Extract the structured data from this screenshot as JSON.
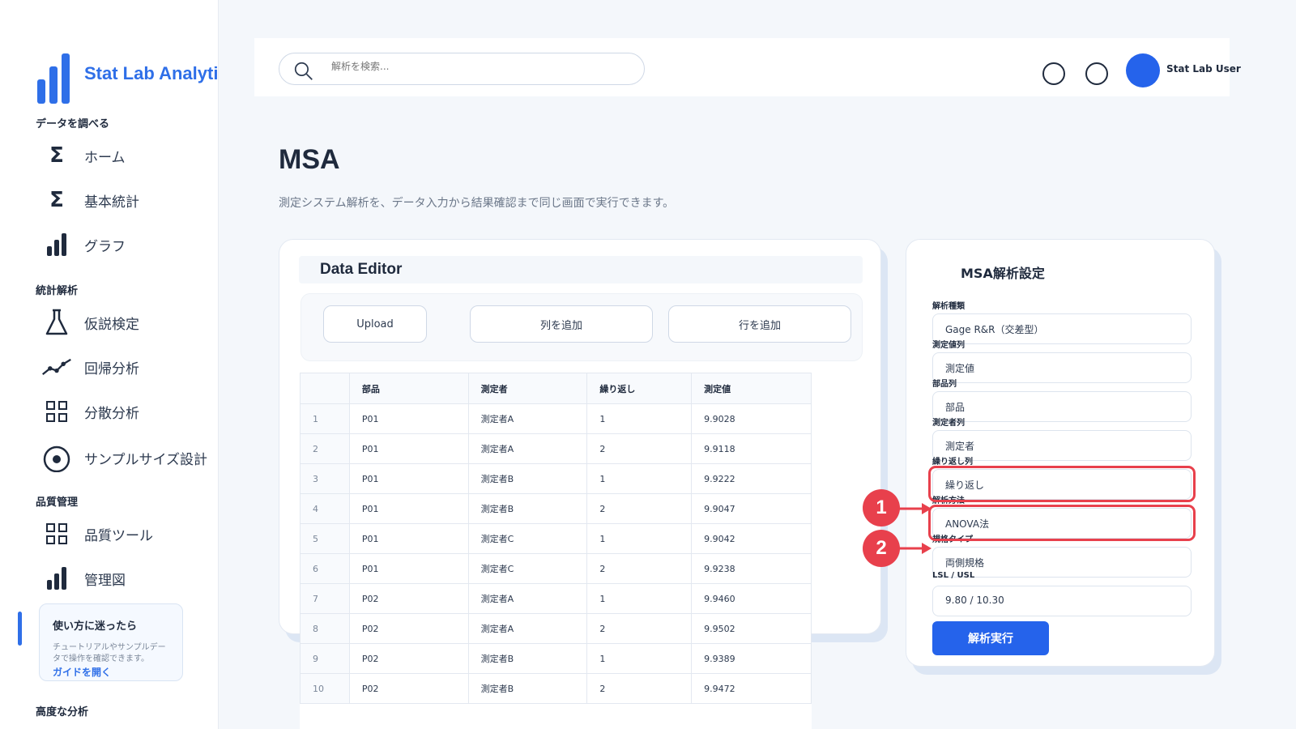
{
  "brand": {
    "name": "Stat Lab Analytics"
  },
  "sidebar": {
    "sections": [
      {
        "label": "データを調べる"
      },
      {
        "label": "統計解析"
      },
      {
        "label": "品質管理"
      },
      {
        "label": "高度な分析"
      }
    ],
    "items": [
      {
        "label": "ホーム",
        "icon": "sigma-icon"
      },
      {
        "label": "基本統計",
        "icon": "sigma-icon"
      },
      {
        "label": "グラフ",
        "icon": "bar-chart-icon"
      },
      {
        "label": "仮説検定",
        "icon": "flask-icon"
      },
      {
        "label": "回帰分析",
        "icon": "trend-line-icon"
      },
      {
        "label": "分散分析",
        "icon": "grid-icon"
      },
      {
        "label": "サンプルサイズ設計",
        "icon": "target-icon"
      },
      {
        "label": "品質ツール",
        "icon": "grid-icon"
      },
      {
        "label": "管理図",
        "icon": "bar-chart-icon"
      }
    ],
    "help": {
      "title": "使い方に迷ったら",
      "text": "チュートリアルやサンプルデータで操作を確認できます。",
      "link": "ガイドを開く"
    }
  },
  "topbar": {
    "search_placeholder": "解析を検索...",
    "user_name": "Stat Lab User"
  },
  "page": {
    "title": "MSA",
    "description": "測定システム解析を、データ入力から結果確認まで同じ画面で実行できます。"
  },
  "editor": {
    "title": "Data Editor",
    "buttons": {
      "upload": "Upload",
      "add_column": "列を追加",
      "add_row": "行を追加"
    },
    "columns": [
      "",
      "部品",
      "測定者",
      "繰り返し",
      "測定値"
    ],
    "rows": [
      [
        "1",
        "P01",
        "測定者A",
        "1",
        "9.9028"
      ],
      [
        "2",
        "P01",
        "測定者A",
        "2",
        "9.9118"
      ],
      [
        "3",
        "P01",
        "測定者B",
        "1",
        "9.9222"
      ],
      [
        "4",
        "P01",
        "測定者B",
        "2",
        "9.9047"
      ],
      [
        "5",
        "P01",
        "測定者C",
        "1",
        "9.9042"
      ],
      [
        "6",
        "P01",
        "測定者C",
        "2",
        "9.9238"
      ],
      [
        "7",
        "P02",
        "測定者A",
        "1",
        "9.9460"
      ],
      [
        "8",
        "P02",
        "測定者A",
        "2",
        "9.9502"
      ],
      [
        "9",
        "P02",
        "測定者B",
        "1",
        "9.9389"
      ],
      [
        "10",
        "P02",
        "測定者B",
        "2",
        "9.9472"
      ]
    ]
  },
  "settings": {
    "title": "MSA解析設定",
    "fields": [
      {
        "label": "解析種類",
        "value": "Gage R&R（交差型）"
      },
      {
        "label": "測定値列",
        "value": "測定値"
      },
      {
        "label": "部品列",
        "value": "部品"
      },
      {
        "label": "測定者列",
        "value": "測定者"
      },
      {
        "label": "繰り返し列",
        "value": "繰り返し"
      },
      {
        "label": "解析方法",
        "value": "ANOVA法"
      },
      {
        "label": "規格タイプ",
        "value": "両側規格"
      },
      {
        "label": "LSL / USL",
        "value": "9.80 / 10.30"
      }
    ],
    "run_button": "解析実行"
  },
  "annotations": {
    "badges": [
      "1",
      "2"
    ],
    "color": "#e8404c"
  },
  "colors": {
    "accent": "#2563eb",
    "brand": "#2f6fe8"
  }
}
